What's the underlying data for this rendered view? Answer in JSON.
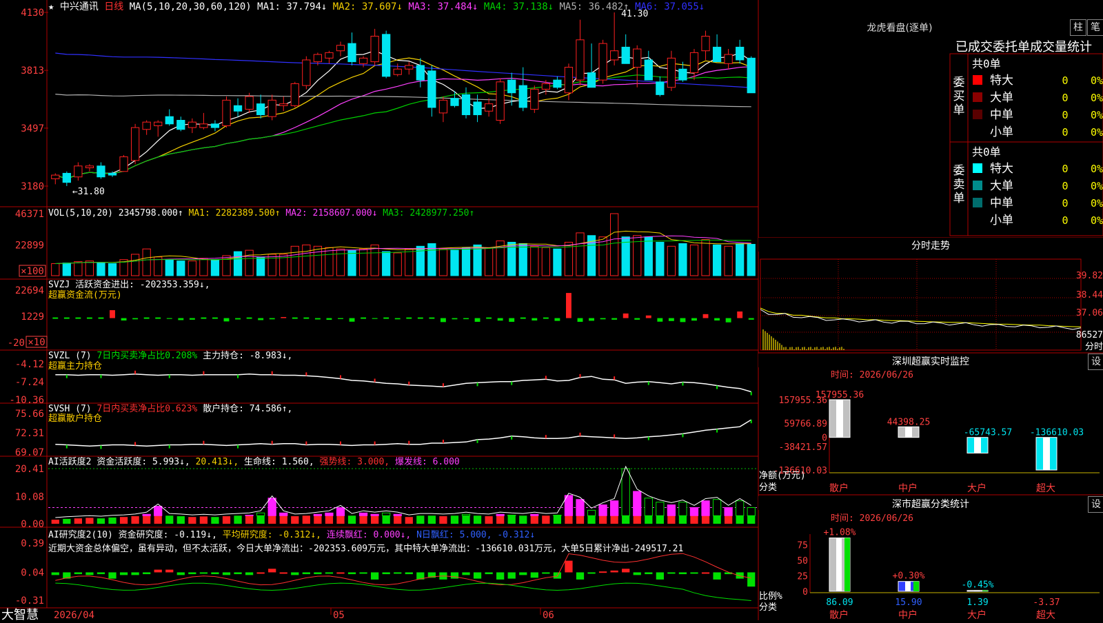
{
  "app": {
    "brand": "大智慧"
  },
  "colors": {
    "up": "#ff2020",
    "down": "#00e5f0",
    "frame": "#b00000",
    "ma1": "#ffffff",
    "ma2": "#f5d000",
    "ma3": "#ff40ff",
    "ma4": "#00d000",
    "ma5": "#b0b0b0",
    "ma6": "#3030ff",
    "buy_green": "#00e000"
  },
  "main": {
    "stock_name": "中兴通讯",
    "period": "日线",
    "ma_label": "MA(5,10,20,30,60,120)",
    "ma_values": [
      {
        "label": "MA1:",
        "value": "37.794",
        "arrow": "↓",
        "color": "#ffffff"
      },
      {
        "label": "MA2:",
        "value": "37.607",
        "arrow": "↓",
        "color": "#f5d000"
      },
      {
        "label": "MA3:",
        "value": "37.484",
        "arrow": "↓",
        "color": "#ff40ff"
      },
      {
        "label": "MA4:",
        "value": "37.138",
        "arrow": "↓",
        "color": "#00d000"
      },
      {
        "label": "MA5:",
        "value": "36.482",
        "arrow": "↑",
        "color": "#b0b0b0"
      },
      {
        "label": "MA6:",
        "value": "37.055",
        "arrow": "↓",
        "color": "#3030ff"
      }
    ],
    "y_ticks": [
      "4130",
      "3813",
      "3497",
      "3180"
    ],
    "high_label": "41.30",
    "low_label": "←31.80",
    "date_labels": [
      "2026/04",
      "05",
      "06"
    ]
  },
  "chart_data": [
    {
      "type": "candlestick",
      "id": "price",
      "ylim": [
        31.8,
        41.3
      ],
      "y_ticks": [
        41.3,
        38.13,
        34.97,
        31.8
      ],
      "ohlc": [
        [
          32.2,
          32.5,
          31.9,
          32.4
        ],
        [
          32.5,
          32.6,
          31.8,
          32.0
        ],
        [
          32.3,
          33.1,
          32.1,
          32.9
        ],
        [
          32.8,
          33.0,
          32.6,
          32.9
        ],
        [
          32.9,
          33.1,
          32.2,
          32.3
        ],
        [
          32.5,
          32.6,
          32.3,
          32.4
        ],
        [
          32.6,
          33.5,
          32.6,
          33.4
        ],
        [
          33.2,
          35.2,
          33.0,
          35.0
        ],
        [
          34.9,
          35.4,
          34.6,
          35.3
        ],
        [
          35.1,
          35.4,
          34.5,
          35.3
        ],
        [
          35.6,
          36.0,
          35.1,
          35.2
        ],
        [
          35.4,
          35.6,
          34.8,
          34.9
        ],
        [
          35.0,
          35.5,
          34.7,
          35.3
        ],
        [
          35.0,
          35.8,
          34.9,
          35.2
        ],
        [
          35.2,
          35.4,
          34.8,
          35.0
        ],
        [
          35.1,
          36.7,
          35.0,
          36.5
        ],
        [
          36.2,
          36.6,
          35.6,
          35.9
        ],
        [
          36.0,
          36.9,
          35.8,
          36.7
        ],
        [
          36.3,
          36.8,
          35.5,
          35.7
        ],
        [
          35.6,
          36.8,
          35.4,
          36.5
        ],
        [
          36.2,
          36.7,
          35.9,
          36.3
        ],
        [
          36.2,
          37.5,
          36.1,
          37.4
        ],
        [
          37.3,
          38.9,
          37.1,
          38.7
        ],
        [
          38.6,
          39.1,
          38.4,
          39.0
        ],
        [
          38.8,
          39.2,
          38.5,
          39.1
        ],
        [
          39.2,
          39.7,
          38.9,
          39.5
        ],
        [
          39.6,
          40.2,
          38.4,
          38.6
        ],
        [
          38.5,
          38.9,
          38.3,
          38.8
        ],
        [
          38.6,
          40.4,
          38.4,
          40.0
        ],
        [
          40.1,
          40.3,
          37.7,
          37.8
        ],
        [
          37.9,
          38.5,
          37.8,
          38.2
        ],
        [
          38.2,
          38.6,
          37.9,
          38.4
        ],
        [
          38.4,
          38.8,
          37.2,
          37.6
        ],
        [
          38.1,
          38.4,
          35.6,
          36.1
        ],
        [
          35.8,
          36.7,
          35.3,
          36.5
        ],
        [
          36.6,
          37.0,
          36.1,
          36.2
        ],
        [
          36.8,
          37.2,
          35.5,
          35.7
        ],
        [
          36.4,
          36.8,
          35.3,
          35.7
        ],
        [
          35.9,
          36.6,
          35.6,
          36.3
        ],
        [
          35.4,
          37.7,
          35.2,
          37.5
        ],
        [
          37.6,
          38.0,
          36.2,
          36.9
        ],
        [
          37.3,
          38.3,
          35.9,
          36.1
        ],
        [
          36.0,
          37.3,
          35.8,
          37.1
        ],
        [
          37.1,
          37.6,
          36.8,
          37.4
        ],
        [
          37.6,
          37.8,
          37.1,
          37.2
        ],
        [
          36.9,
          38.5,
          36.5,
          38.3
        ],
        [
          37.6,
          40.9,
          37.3,
          39.8
        ],
        [
          38.0,
          39.6,
          37.5,
          37.2
        ],
        [
          37.6,
          39.8,
          37.4,
          39.6
        ],
        [
          38.7,
          41.3,
          38.4,
          39.2
        ],
        [
          39.4,
          40.1,
          38.8,
          38.5
        ],
        [
          38.3,
          39.5,
          37.2,
          39.3
        ],
        [
          38.7,
          39.2,
          37.9,
          37.6
        ],
        [
          37.5,
          37.8,
          36.7,
          36.8
        ],
        [
          37.2,
          39.2,
          37.0,
          38.8
        ],
        [
          38.2,
          38.6,
          37.5,
          37.6
        ],
        [
          38.0,
          39.3,
          37.6,
          39.1
        ],
        [
          39.2,
          40.3,
          38.7,
          40.0
        ],
        [
          39.4,
          40.1,
          38.6,
          38.6
        ],
        [
          38.5,
          39.3,
          38.2,
          39.0
        ],
        [
          39.4,
          39.8,
          38.5,
          38.7
        ],
        [
          38.8,
          38.9,
          37.1,
          36.9
        ]
      ],
      "ma_series_names": [
        "MA1",
        "MA2",
        "MA3",
        "MA4",
        "MA5",
        "MA6"
      ]
    },
    {
      "type": "bar",
      "id": "volume",
      "title": "VOL(5,10,20)",
      "readout": [
        {
          "label": "",
          "value": "2345798.000",
          "arrow": "↑",
          "color": "#ffffff"
        },
        {
          "label": "MA1:",
          "value": "2282389.500",
          "arrow": "↑",
          "color": "#f5d000"
        },
        {
          "label": "MA2:",
          "value": "2158607.000",
          "arrow": "↓",
          "color": "#ff40ff"
        },
        {
          "label": "MA3:",
          "value": "2428977.250",
          "arrow": "↑",
          "color": "#00d000"
        }
      ],
      "y_ticks": [
        "46371",
        "22899",
        "×100"
      ],
      "ylim": [
        0,
        46371
      ],
      "values": [
        9000,
        9500,
        10500,
        11000,
        9800,
        9000,
        12000,
        16000,
        20000,
        14000,
        12000,
        11000,
        11000,
        13000,
        12000,
        15000,
        18000,
        19000,
        14000,
        16000,
        16000,
        22000,
        23000,
        22000,
        21000,
        20000,
        19000,
        20000,
        23000,
        18000,
        17000,
        20000,
        22000,
        24000,
        20000,
        19000,
        21000,
        23000,
        21000,
        26000,
        25000,
        24000,
        22000,
        21000,
        20000,
        25000,
        32000,
        30000,
        29000,
        46371,
        29000,
        30000,
        29000,
        25000,
        22000,
        24000,
        23000,
        27000,
        23000,
        22000,
        24000,
        23458
      ]
    },
    {
      "type": "bar",
      "id": "svzj",
      "title": "SVZJ",
      "label": "活跃资金进出:",
      "value": "-202353.359",
      "arrow": "↓",
      "subtitle": "超赢资金流(万元)",
      "y_ticks": [
        "22694",
        "1229",
        "-20",
        "×10"
      ],
      "ylim": [
        -20000,
        22694
      ],
      "values": [
        300,
        -200,
        200,
        -500,
        400,
        6000,
        -1800,
        -900,
        -500,
        400,
        -600,
        -1500,
        -1200,
        400,
        300,
        -2500,
        -1000,
        300,
        -1500,
        -900,
        800,
        300,
        -500,
        -1000,
        -1300,
        -700,
        -2700,
        300,
        -600,
        400,
        -900,
        300,
        -400,
        -300,
        -3000,
        -900,
        -800,
        -2800,
        500,
        -1900,
        -2800,
        -300,
        -1800,
        -400,
        -2100,
        19000,
        -2800,
        -2000,
        -900,
        -1200,
        3500,
        -1200,
        2000,
        -2700,
        -2200,
        -3000,
        -1900,
        3000,
        -1800,
        -3200,
        5000,
        -1200,
        -3800,
        -3200
      ]
    },
    {
      "type": "line",
      "id": "svzl",
      "title": "SVZL",
      "param": "(7)",
      "metric": "7日内买卖净占比0.208%",
      "label": "主力持仓:",
      "value": "-8.983",
      "arrow": "↓",
      "subtitle": "超赢主力持仓",
      "y_ticks": [
        "-4.12",
        "-7.24",
        "-10.36"
      ],
      "ylim": [
        -10.36,
        -4.12
      ],
      "values": [
        -6.0,
        -6.0,
        -6.1,
        -6.0,
        -6.0,
        -6.1,
        -6.0,
        -5.9,
        -6.0,
        -6.1,
        -6.0,
        -6.0,
        -6.1,
        -6.0,
        -6.0,
        -6.0,
        -6.0,
        -5.9,
        -6.0,
        -6.0,
        -6.1,
        -6.1,
        -6.2,
        -6.3,
        -6.5,
        -6.7,
        -7.0,
        -7.1,
        -7.3,
        -7.5,
        -7.6,
        -7.8,
        -7.9,
        -8.0,
        -8.1,
        -7.8,
        -7.5,
        -7.4,
        -7.3,
        -7.2,
        -7.2,
        -7.0,
        -6.9,
        -6.8,
        -7.1,
        -7.0,
        -6.5,
        -6.3,
        -6.8,
        -6.9,
        -7.5,
        -7.3,
        -7.2,
        -7.4,
        -7.6,
        -7.3,
        -7.4,
        -7.6,
        -7.9,
        -8.2,
        -8.4,
        -8.983
      ]
    },
    {
      "type": "line",
      "id": "svsh",
      "title": "SVSH",
      "param": "(7)",
      "metric": "7日内买卖净占比0.623%",
      "label": "散户持仓:",
      "value": "74.586",
      "arrow": "↑",
      "subtitle": "超赢散户持仓",
      "y_ticks": [
        "75.66",
        "72.31",
        "69.07"
      ],
      "ylim": [
        69.07,
        75.66
      ],
      "values": [
        70.4,
        70.3,
        70.2,
        70.1,
        70.2,
        70.3,
        70.3,
        70.2,
        70.1,
        70.2,
        70.3,
        70.3,
        70.4,
        70.4,
        70.3,
        70.2,
        70.3,
        70.4,
        70.5,
        70.4,
        70.5,
        70.5,
        70.3,
        70.4,
        70.4,
        70.3,
        70.2,
        70.3,
        70.3,
        70.4,
        70.5,
        70.4,
        70.4,
        70.6,
        70.6,
        70.7,
        70.8,
        71.2,
        71.3,
        71.5,
        71.8,
        71.7,
        71.5,
        71.4,
        71.4,
        71.5,
        71.8,
        71.7,
        71.6,
        71.5,
        71.4,
        71.5,
        71.7,
        71.8,
        72.0,
        72.2,
        72.5,
        72.8,
        73.0,
        73.2,
        73.4,
        74.586
      ]
    },
    {
      "type": "bar",
      "id": "ai_active",
      "title": "AI活跃度2",
      "label": "资金活跃度:",
      "value": "5.993",
      "arrow": "↓",
      "extra1": "20.413",
      "extra2_label": "生命线:",
      "extra2": "1.560",
      "extra3": "强势线: 3.000",
      "extra4": "爆发线: 6.000",
      "y_ticks": [
        "20.41",
        "10.08",
        "0.00"
      ],
      "ylim": [
        0,
        20.41
      ],
      "values": [
        1.5,
        1.8,
        2.0,
        2.2,
        2.0,
        2.3,
        2.5,
        2.8,
        3.5,
        6.5,
        3.0,
        2.8,
        2.5,
        2.7,
        2.5,
        2.8,
        3.0,
        3.2,
        4.0,
        9.5,
        4.0,
        2.8,
        3.0,
        3.5,
        4.0,
        6.0,
        3.0,
        4.0,
        3.5,
        4.0,
        3.5,
        2.5,
        3.0,
        3.0,
        2.8,
        3.0,
        3.5,
        3.0,
        2.8,
        3.5,
        3.2,
        3.0,
        3.5,
        3.0,
        3.2,
        10.5,
        9.0,
        5.0,
        7.0,
        8.5,
        20.41,
        12.0,
        9.5,
        8.0,
        7.0,
        8.0,
        6.0,
        8.5,
        9.0,
        6.0,
        8.5,
        5.993
      ]
    },
    {
      "type": "bar",
      "id": "ai_research",
      "title": "AI研究度2(10)",
      "label": "资金研究度:",
      "value": "-0.119",
      "arrow": "↓",
      "avg_label": "平均研究度:",
      "avg": "-0.312",
      "streak_label": "连续飘红:",
      "streak": "0.000",
      "nday_label": "N日飘红:",
      "nday": "5.000",
      "nday2": "-0.312",
      "comment": "近期大资金总体偏空，虽有异动，但不太活跃，今日大单净流出：-202353.609万元，其中特大单净流出：-136610.031万元，大单5日累计净出-249517.21",
      "y_ticks": [
        "0.39",
        "0.04",
        "-0.31"
      ],
      "ylim": [
        -0.31,
        0.39
      ],
      "values": [
        0.01,
        -0.03,
        0.02,
        0.01,
        0.02,
        -0.03,
        0.01,
        0.01,
        0.02,
        0.07,
        0.07,
        0.01,
        0.02,
        0.03,
        0.02,
        0.01,
        0.02,
        0.01,
        0.04,
        0.08,
        0.04,
        0.01,
        0.02,
        0.02,
        0.03,
        0.04,
        0.02,
        0.03,
        -0.04,
        0.02,
        0.03,
        0.02,
        -0.04,
        -0.02,
        -0.04,
        -0.03,
        0.01,
        -0.03,
        0.02,
        -0.04,
        -0.03,
        0.01,
        -0.02,
        0.03,
        -0.03,
        0.17,
        -0.04,
        0.03,
        0.05,
        0.06,
        0.08,
        0.01,
        0.02,
        -0.04,
        0.03,
        0.02,
        0.03,
        0.04,
        -0.04,
        0.02,
        -0.03,
        -0.119
      ]
    },
    {
      "type": "line",
      "id": "intraday",
      "title": "分时走势",
      "y_ticks": [
        "39.82",
        "38.44",
        "37.06",
        "86527"
      ],
      "footer": "分时",
      "ylim": [
        36.0,
        40.0
      ],
      "values": [
        37.5,
        37.3,
        37.2,
        37.2,
        37.1,
        37.1,
        37.05,
        37.0,
        36.95,
        36.95,
        36.9,
        36.9,
        36.88,
        36.85,
        36.85,
        36.82,
        36.8,
        36.8,
        36.78,
        36.76,
        36.75,
        36.73,
        36.72,
        36.7,
        36.7,
        36.68,
        36.66,
        36.64,
        36.62,
        36.6,
        36.6,
        36.58,
        36.56,
        36.55,
        36.55,
        36.52,
        36.5,
        36.48,
        36.46,
        36.45
      ]
    },
    {
      "type": "bar",
      "id": "sz_monitor",
      "title": "深圳超赢实时监控",
      "time": "时间: 2026/06/26",
      "y_ticks": [
        "157955.36",
        "59766.89",
        "0",
        "-38421.57",
        "-136610.03"
      ],
      "ylim": [
        -136610.03,
        157955.36
      ],
      "axis_title": "净额(万元)",
      "axis_sub": "分类",
      "categories": [
        "散户",
        "中户",
        "大户",
        "超大"
      ],
      "values": [
        157955.36,
        44398.25,
        -65743.57,
        -136610.03
      ],
      "value_labels": [
        "157955.36",
        "44398.25",
        "-65743.57",
        "-136610.03"
      ]
    },
    {
      "type": "bar",
      "id": "sz_category",
      "title": "深市超赢分类统计",
      "time": "时间: 2026/06/26",
      "y_ticks": [
        "75",
        "50",
        "25",
        "0"
      ],
      "ylim": [
        0,
        100
      ],
      "axis_title": "比例%",
      "axis_sub": "分类",
      "categories": [
        "散户",
        "中户",
        "大户",
        "超大"
      ],
      "values": [
        86.09,
        15.9,
        1.39,
        -3.37
      ],
      "change_labels": [
        "+1.08%",
        "+0.30%",
        "-0.45%",
        ""
      ],
      "value_labels": [
        "86.09",
        "15.90",
        "1.39",
        "-3.37"
      ]
    }
  ],
  "right_panel": {
    "title": "龙虎看盘(逐单)",
    "btn_bar": "柱",
    "btn_tick": "笔",
    "table_title": "已成交委托单成交量统计",
    "buy_section": {
      "side": "委买单",
      "total": "共0单",
      "rows": [
        {
          "name": "特大",
          "count": "0",
          "pct": "0%",
          "color": "#ff0000"
        },
        {
          "name": "大单",
          "count": "0",
          "pct": "0%",
          "color": "#8b0000"
        },
        {
          "name": "中单",
          "count": "0",
          "pct": "0%",
          "color": "#5a0000"
        },
        {
          "name": "小单",
          "count": "0",
          "pct": "0%",
          "color": ""
        }
      ]
    },
    "sell_section": {
      "side": "委卖单",
      "total": "共0单",
      "rows": [
        {
          "name": "特大",
          "count": "0",
          "pct": "0%",
          "color": "#00ffff"
        },
        {
          "name": "大单",
          "count": "0",
          "pct": "0%",
          "color": "#008b8b"
        },
        {
          "name": "中单",
          "count": "0",
          "pct": "0%",
          "color": "#006d6d"
        },
        {
          "name": "小单",
          "count": "0",
          "pct": "0%",
          "color": ""
        }
      ]
    },
    "set_btn": "设"
  }
}
